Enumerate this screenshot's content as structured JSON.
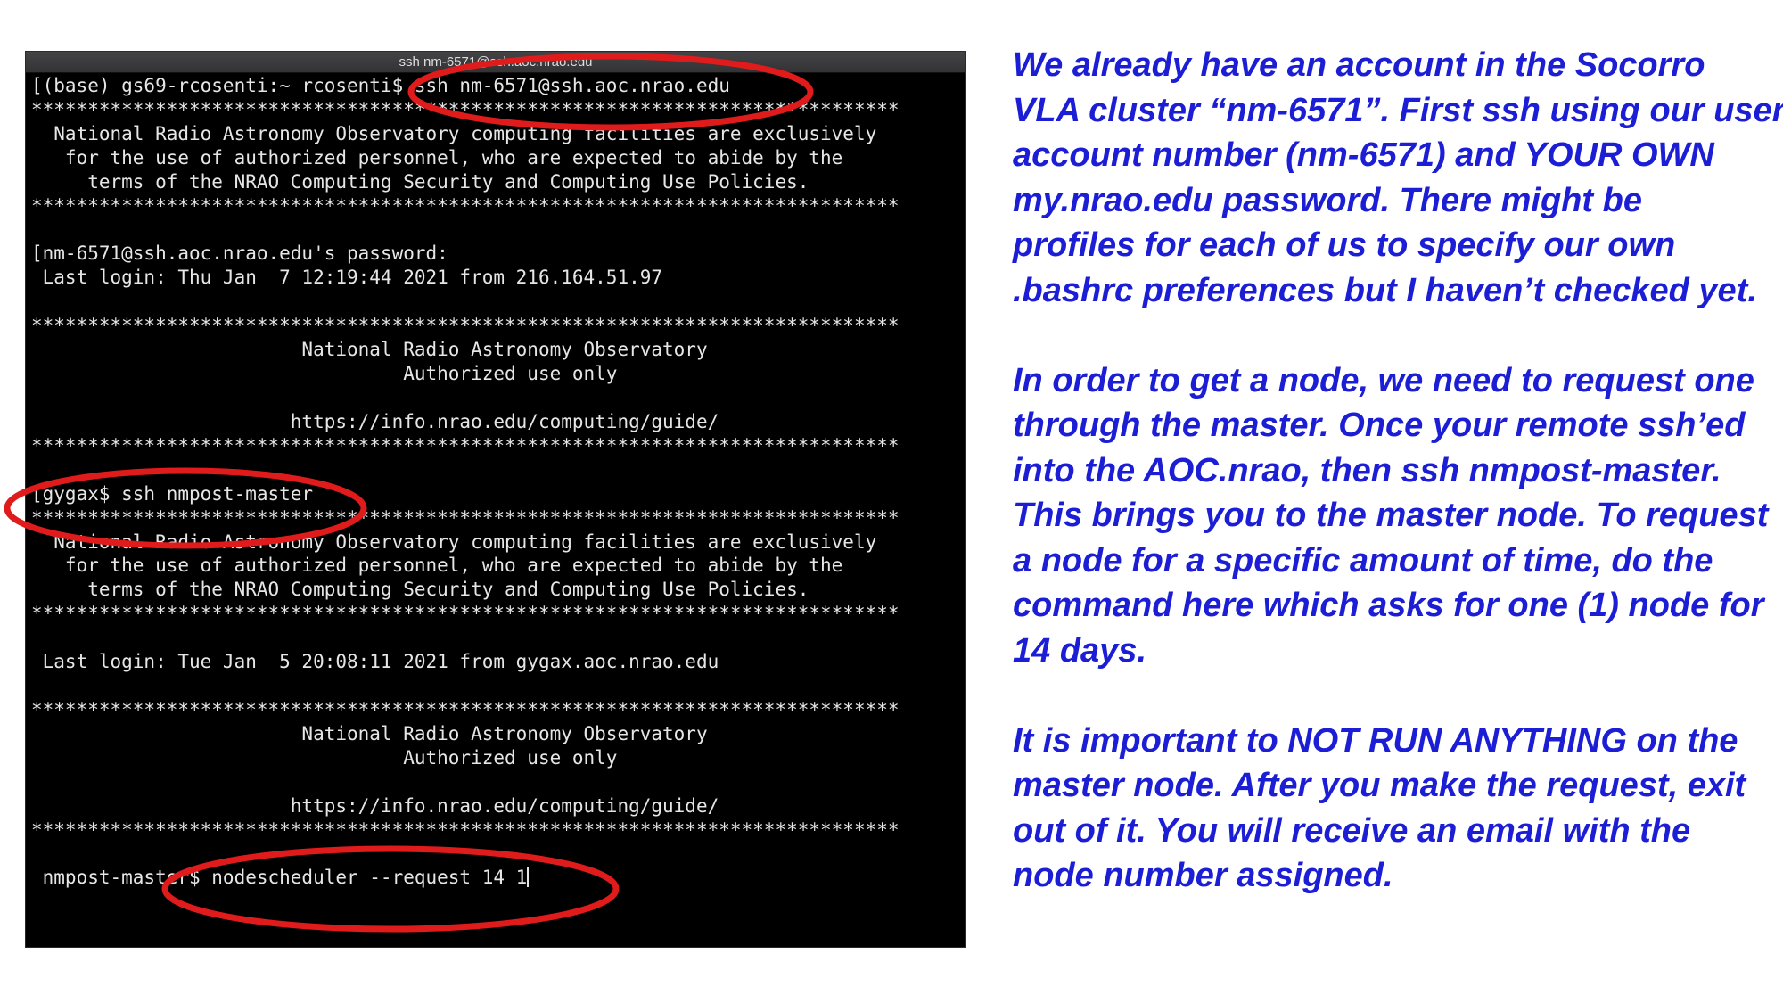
{
  "terminal": {
    "title": "ssh nm-6571@ssh.aoc.nrao.edu",
    "lines": [
      "[(base) gs69-rcosenti:~ rcosenti$ ssh nm-6571@ssh.aoc.nrao.edu",
      "*****************************************************************************",
      "  National Radio Astronomy Observatory computing facilities are exclusively",
      "   for the use of authorized personnel, who are expected to abide by the",
      "     terms of the NRAO Computing Security and Computing Use Policies.",
      "*****************************************************************************",
      "",
      "[nm-6571@ssh.aoc.nrao.edu's password:",
      " Last login: Thu Jan  7 12:19:44 2021 from 216.164.51.97",
      "",
      "*****************************************************************************",
      "                        National Radio Astronomy Observatory",
      "                                 Authorized use only",
      "",
      "                       https://info.nrao.edu/computing/guide/",
      "*****************************************************************************",
      "",
      "[gygax$ ssh nmpost-master",
      "*****************************************************************************",
      "  National Radio Astronomy Observatory computing facilities are exclusively",
      "   for the use of authorized personnel, who are expected to abide by the",
      "     terms of the NRAO Computing Security and Computing Use Policies.",
      "*****************************************************************************",
      "",
      " Last login: Tue Jan  5 20:08:11 2021 from gygax.aoc.nrao.edu",
      "",
      "*****************************************************************************",
      "                        National Radio Astronomy Observatory",
      "                                 Authorized use only",
      "",
      "                       https://info.nrao.edu/computing/guide/",
      "*****************************************************************************",
      "",
      " nmpost-master$ nodescheduler --request 14 1"
    ]
  },
  "annotations": {
    "circle_color": "#e01b1b"
  },
  "notes": {
    "paragraph1": [
      "We already have an account in the Socorro",
      "VLA cluster “nm-6571”. First ssh using our user",
      "account number (nm-6571) and YOUR OWN",
      "my.nrao.edu password. There might be",
      "profiles for each of us to specify our own",
      ".bashrc preferences but I haven’t checked yet."
    ],
    "paragraph2": [
      "In order to get a node, we need to request one",
      "through the master. Once your remote ssh’ed",
      "into the AOC.nrao, then ssh nmpost-master.",
      "This brings you to the master node. To request",
      "a node for a specific amount of time, do the",
      "command here which asks for one (1) node for",
      "14 days."
    ],
    "paragraph3": [
      "It is important to NOT RUN ANYTHING on the",
      "master node. After you make the request, exit",
      "out of it. You will receive an email with the",
      "node number assigned."
    ],
    "text_color": "#1c1ed6"
  }
}
